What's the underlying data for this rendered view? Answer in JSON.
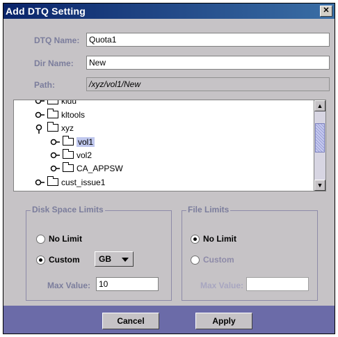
{
  "window": {
    "title": "Add DTQ Setting",
    "close_glyph": "✕"
  },
  "form": {
    "dtq_name": {
      "label": "DTQ Name:",
      "value": "Quota1"
    },
    "dir_name": {
      "label": "Dir Name:",
      "value": "New"
    },
    "path": {
      "label": "Path:",
      "value": "/xyz/vol1/New"
    }
  },
  "tree": {
    "items": [
      {
        "label": "kldu",
        "expander": "expand"
      },
      {
        "label": "kltools",
        "expander": "expand"
      },
      {
        "label": "xyz",
        "expander": "collapse"
      },
      {
        "label": "vol1",
        "expander": "expand",
        "selected": true
      },
      {
        "label": "vol2",
        "expander": "expand"
      },
      {
        "label": "CA_APPSW",
        "expander": "expand"
      },
      {
        "label": "cust_issue1",
        "expander": "expand"
      }
    ],
    "scroll_up_glyph": "▲",
    "scroll_down_glyph": "▼"
  },
  "disk_space_limits": {
    "title": "Disk Space Limits",
    "no_limit_label": "No Limit",
    "custom_label": "Custom",
    "selected": "custom",
    "unit": "GB",
    "max_value_label": "Max Value:",
    "max_value": "10"
  },
  "file_limits": {
    "title": "File Limits",
    "no_limit_label": "No Limit",
    "custom_label": "Custom",
    "selected": "no_limit",
    "max_value_label": "Max Value:",
    "max_value": ""
  },
  "buttons": {
    "cancel": "Cancel",
    "apply": "Apply"
  },
  "colors": {
    "titlebar": "#0a246a",
    "dialog_bg": "#c6c3c6",
    "button_bar": "#6b6ba8",
    "label": "#7b7d9c",
    "selection": "#c0c8ee"
  },
  "icons": {
    "folder": "folder-icon",
    "expander": "tree-expander-icon"
  }
}
